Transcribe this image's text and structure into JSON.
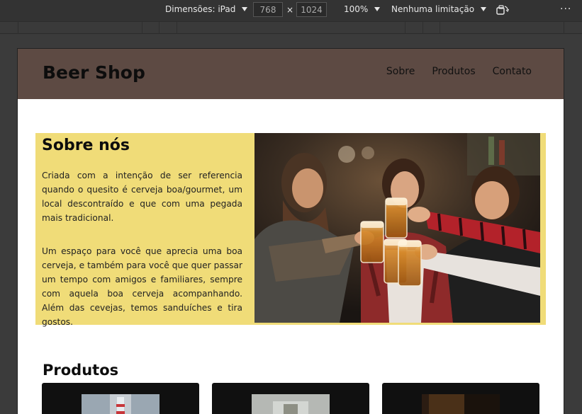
{
  "devtools": {
    "dimensions_label": "Dimensões: iPad",
    "width_value": "768",
    "times_symbol": "×",
    "height_value": "1024",
    "zoom_label": "100%",
    "throttle_label": "Nenhuma limitação",
    "more_label": "⋮"
  },
  "site": {
    "brand": "Beer Shop",
    "nav": [
      "Sobre",
      "Produtos",
      "Contato"
    ],
    "header_color": "#5d4a43"
  },
  "about": {
    "title": "Sobre nós",
    "paragraphs": [
      "Criada com a intenção de ser referencia quando o quesito é cerveja boa/gourmet, um local descontraído e que com uma pegada mais tradicional.",
      "Um espaço para você que aprecia uma boa cerveja, e também para você que quer passar um tempo com amigos e familiares, sempre com aquela boa cerveja acompanhando. Além das cevejas, temos sanduíches e tira gostos."
    ],
    "background_color": "#f0dc78",
    "image_icon": "friends-toasting-beer-photo"
  },
  "products": {
    "title": "Produtos",
    "cards": [
      {
        "icon": "beer-bottle-photo"
      },
      {
        "icon": "beer-glass-photo"
      },
      {
        "icon": "dark-beer-photo"
      }
    ]
  }
}
